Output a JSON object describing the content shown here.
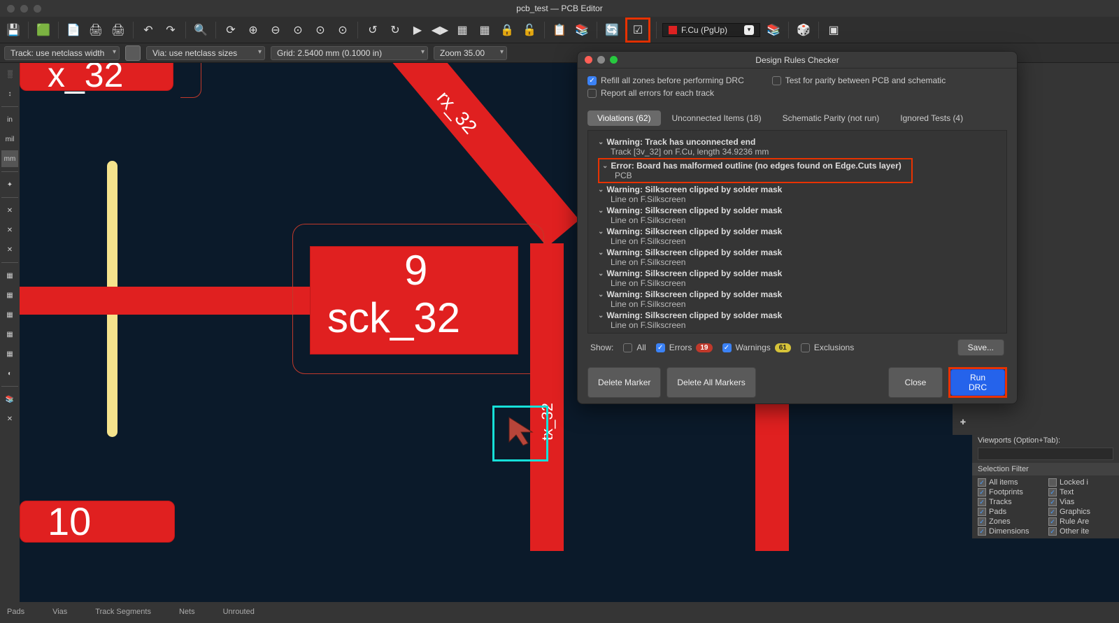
{
  "window": {
    "title": "pcb_test — PCB Editor"
  },
  "toolbar1": {
    "layer": "F.Cu (PgUp)"
  },
  "toolbar2": {
    "track": "Track: use netclass width",
    "via": "Via: use netclass sizes",
    "grid": "Grid: 2.5400 mm (0.1000 in)",
    "zoom": "Zoom 35.00"
  },
  "left_tools": [
    "grid",
    "in",
    "mil",
    "mm"
  ],
  "canvas": {
    "pad_top_label": "x_32",
    "pad_mid_num": "9",
    "pad_mid_net": "sck_32",
    "diag_label": "rx_32",
    "vert_label": "tx_32",
    "pad_bot": "10"
  },
  "right_panel": {
    "viewports_label": "Viewports (Option+Tab):",
    "sel_filter_title": "Selection Filter",
    "filters": [
      {
        "label": "All items",
        "checked": true
      },
      {
        "label": "Locked i",
        "checked": false
      },
      {
        "label": "Footprints",
        "checked": true
      },
      {
        "label": "Text",
        "checked": true
      },
      {
        "label": "Tracks",
        "checked": true
      },
      {
        "label": "Vias",
        "checked": true
      },
      {
        "label": "Pads",
        "checked": true
      },
      {
        "label": "Graphics",
        "checked": true
      },
      {
        "label": "Zones",
        "checked": true
      },
      {
        "label": "Rule Are",
        "checked": true
      },
      {
        "label": "Dimensions",
        "checked": true
      },
      {
        "label": "Other ite",
        "checked": true
      }
    ]
  },
  "statusbar": {
    "pads": "Pads",
    "vias": "Vias",
    "tracks": "Track Segments",
    "nets": "Nets",
    "unrouted": "Unrouted"
  },
  "drc": {
    "title": "Design Rules Checker",
    "opt_refill": "Refill all zones before performing DRC",
    "opt_parity": "Test for parity between PCB and schematic",
    "opt_allerr": "Report all errors for each track",
    "tabs": {
      "violations": "Violations (62)",
      "unconnected": "Unconnected Items (18)",
      "parity": "Schematic Parity (not run)",
      "ignored": "Ignored Tests (4)"
    },
    "violations": [
      {
        "title": "Warning: Track has unconnected end",
        "sub": "Track [3v_32] on F.Cu, length 34.9236 mm"
      },
      {
        "title": "Error: Board has malformed outline (no edges found on Edge.Cuts layer)",
        "sub": "PCB",
        "error": true
      },
      {
        "title": "Warning: Silkscreen clipped by solder mask",
        "sub": "Line on F.Silkscreen"
      },
      {
        "title": "Warning: Silkscreen clipped by solder mask",
        "sub": "Line on F.Silkscreen"
      },
      {
        "title": "Warning: Silkscreen clipped by solder mask",
        "sub": "Line on F.Silkscreen"
      },
      {
        "title": "Warning: Silkscreen clipped by solder mask",
        "sub": "Line on F.Silkscreen"
      },
      {
        "title": "Warning: Silkscreen clipped by solder mask",
        "sub": "Line on F.Silkscreen"
      },
      {
        "title": "Warning: Silkscreen clipped by solder mask",
        "sub": "Line on F.Silkscreen"
      },
      {
        "title": "Warning: Silkscreen clipped by solder mask",
        "sub": "Line on F.Silkscreen"
      }
    ],
    "show": {
      "label": "Show:",
      "all": "All",
      "errors": "Errors",
      "err_count": "19",
      "warnings": "Warnings",
      "warn_count": "61",
      "exclusions": "Exclusions",
      "save": "Save..."
    },
    "buttons": {
      "del_marker": "Delete Marker",
      "del_all": "Delete All Markers",
      "close": "Close",
      "run": "Run DRC"
    }
  }
}
